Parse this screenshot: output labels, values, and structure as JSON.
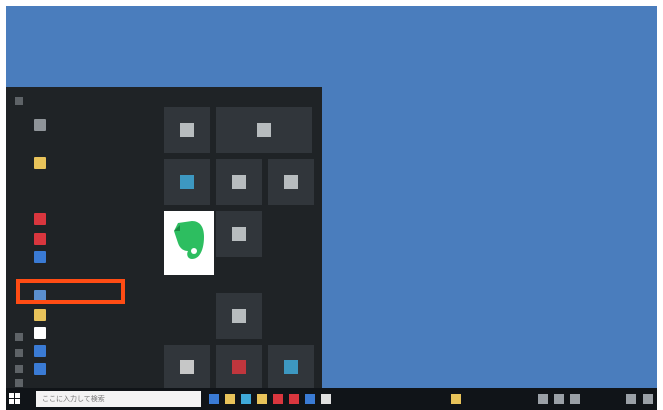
{
  "taskbar": {
    "search_placeholder": "ここに入力して検索",
    "icons": [
      "task-view-icon",
      "explorer-icon",
      "edge-icon",
      "store-icon",
      "mail-icon",
      "office-icon",
      "photos-icon",
      "extra-icon"
    ]
  },
  "colors": {
    "desktop": "#4a7dbd",
    "menu": "#1f2326",
    "tile": "#31363b",
    "highlight": "#ff4c14",
    "evernote_green": "#2dbe60"
  }
}
